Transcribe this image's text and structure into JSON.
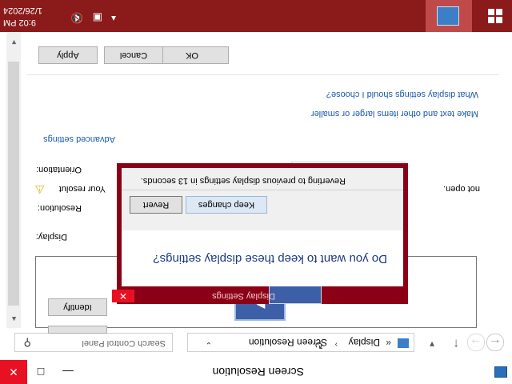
{
  "window": {
    "title": "Screen Resolution",
    "minimize_glyph": "—",
    "maximize_glyph": "□",
    "close_glyph": "✕"
  },
  "address": {
    "breadcrumb_root_chevron": "«",
    "breadcrumb": [
      "Display",
      "Screen Resolution"
    ],
    "separator": "›",
    "dropdown_glyph": "⌄",
    "refresh_glyph": "↻"
  },
  "search": {
    "placeholder": "Search Control Panel",
    "icon": "search-icon"
  },
  "content": {
    "identify_label": "Identify",
    "display_label": "Display:",
    "resolution_label": "Resolution:",
    "warning_text": "Your resolut",
    "warning_tail": "not open.",
    "orientation_label": "Orientation:",
    "advanced_link": "Advanced settings",
    "larger_link": "Make text and other items larger or smaller",
    "which_link": "What display settings should I choose?"
  },
  "buttons": {
    "ok": "OK",
    "cancel": "Cancel",
    "apply": "Apply"
  },
  "dialog": {
    "title": "Display Settings",
    "question": "Do you want to keep these display settings?",
    "keep_label": "Keep changes",
    "revert_label": "Revert",
    "countdown_text": "Reverting to previous display settings in 13 seconds.",
    "close_glyph": "✕"
  },
  "taskbar": {
    "time": "9:02 PM",
    "date": "1/26/2024"
  },
  "colors": {
    "taskbar_bg": "#8b1a1a",
    "dialog_frame": "#8b0016",
    "link": "#1a5aa8",
    "close_red": "#e81123"
  }
}
